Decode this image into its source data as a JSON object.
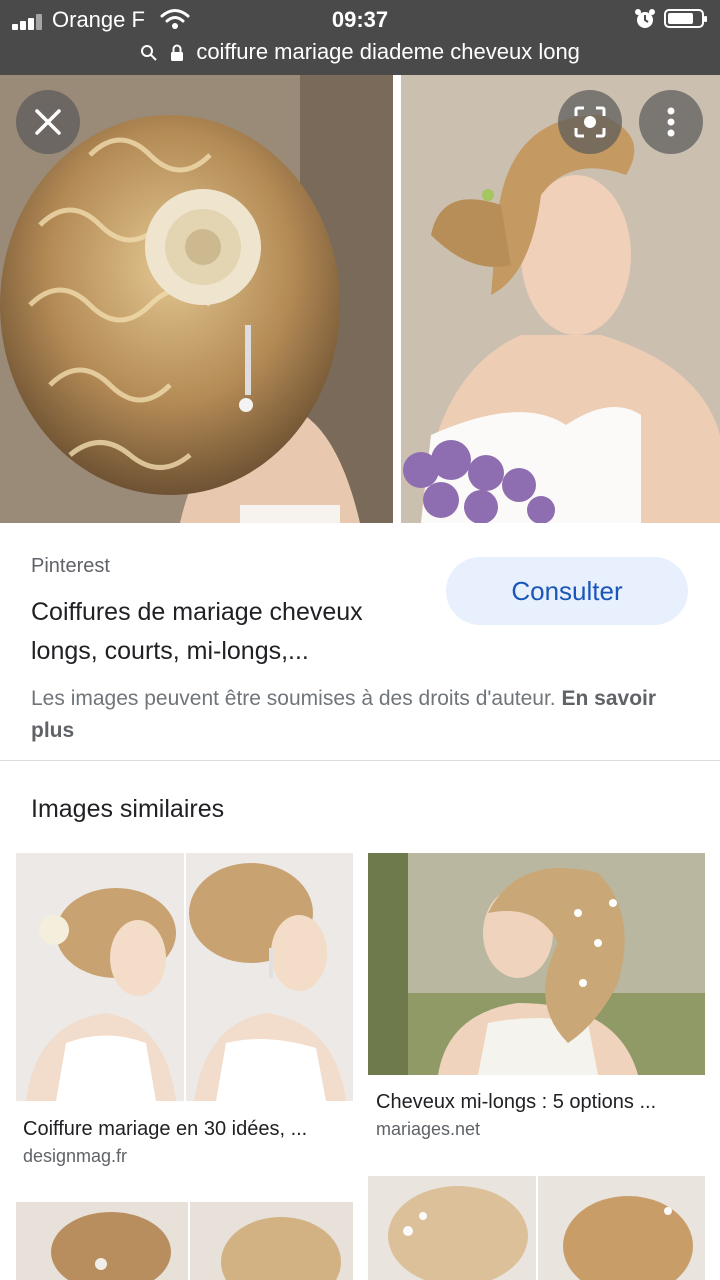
{
  "status_bar": {
    "carrier": "Orange F",
    "time": "09:37",
    "url": "coiffure mariage diademe cheveux long"
  },
  "hero": {
    "close_icon": "close-icon",
    "lens_icon": "lens-icon",
    "more_icon": "more-vert-icon"
  },
  "result": {
    "source": "Pinterest",
    "title": "Coiffures de mariage cheveux longs, courts, mi-longs,...",
    "consult_label": "Consulter",
    "rights_text": "Les images peuvent être soumises à des droits d'auteur.",
    "rights_link": "En savoir plus"
  },
  "similar": {
    "heading": "Images similaires",
    "items": [
      {
        "title": "Coiffure mariage en 30 idées, ...",
        "site": "designmag.fr"
      },
      {
        "title": "Cheveux mi-longs : 5 options ...",
        "site": "mariages.net"
      }
    ]
  }
}
